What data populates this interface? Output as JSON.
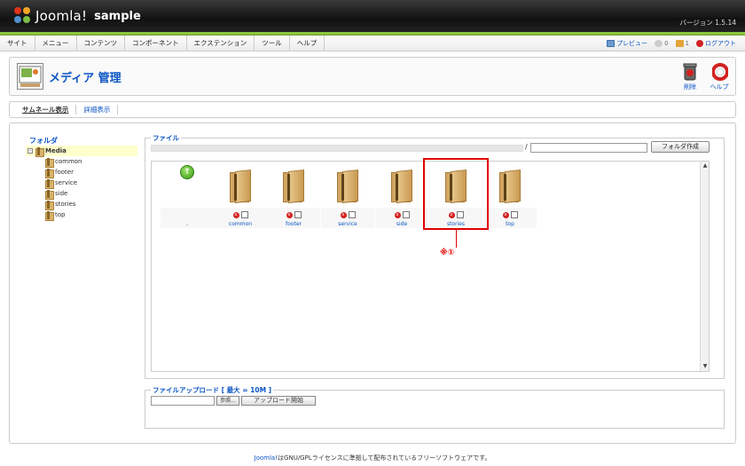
{
  "header": {
    "logo_text": "Joomla!",
    "site_name": "sample",
    "version": "バージョン 1.5.14"
  },
  "menu": {
    "items": [
      "サイト",
      "メニュー",
      "コンテンツ",
      "コンポーネント",
      "エクステンション",
      "ツール",
      "ヘルプ"
    ]
  },
  "status": {
    "preview": "プレビュー",
    "messages_count": "0",
    "users_count": "1",
    "logout": "ログアウト"
  },
  "toolbar": {
    "title": "メディア 管理",
    "delete_label": "削除",
    "help_label": "ヘルプ"
  },
  "submenu": {
    "thumbnail_view": "サムネール表示",
    "detail_view": "詳細表示"
  },
  "tree": {
    "title": "フォルダ",
    "root": "Media",
    "children": [
      "common",
      "footer",
      "service",
      "side",
      "stories",
      "top"
    ]
  },
  "files": {
    "legend": "ファイル",
    "slash": "/",
    "create_folder_label": "フォルダ作成",
    "up_label": "..",
    "folders": [
      "common",
      "footer",
      "service",
      "side",
      "stories",
      "top"
    ],
    "annotation": "※①"
  },
  "upload": {
    "legend": "ファイルアップロード [ 最大 = 10M ]",
    "browse_label": "参照...",
    "start_label": "アップロード開始"
  },
  "footer": {
    "link_text": "Joomla!",
    "text": "はGNU/GPLライセンスに準拠して配布されているフリーソフトウェアです。"
  },
  "colors": {
    "accent_green": "#8cc63f",
    "link_blue": "#0B55C4",
    "highlight_red": "#e00000"
  }
}
